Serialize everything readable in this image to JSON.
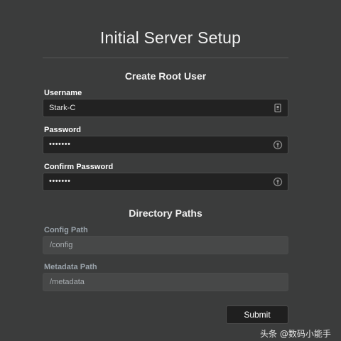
{
  "page_title": "Initial Server Setup",
  "root_user": {
    "section_title": "Create Root User",
    "username": {
      "label": "Username",
      "value": "Stark-C"
    },
    "password": {
      "label": "Password",
      "value": "•••••••"
    },
    "confirm_password": {
      "label": "Confirm Password",
      "value": "•••••••"
    }
  },
  "paths": {
    "section_title": "Directory Paths",
    "config": {
      "label": "Config Path",
      "value": "/config"
    },
    "metadata": {
      "label": "Metadata Path",
      "value": "/metadata"
    }
  },
  "submit_label": "Submit",
  "watermark": "头条 @数码小能手",
  "icons": {
    "username_field": "autofill-card-icon",
    "password_field": "key-reveal-icon",
    "confirm_password_field": "key-reveal-icon"
  },
  "colors": {
    "background": "#3b3c3c",
    "input_background": "#222222",
    "disabled_input_background": "#474848",
    "muted_label": "#9aa3ab"
  }
}
